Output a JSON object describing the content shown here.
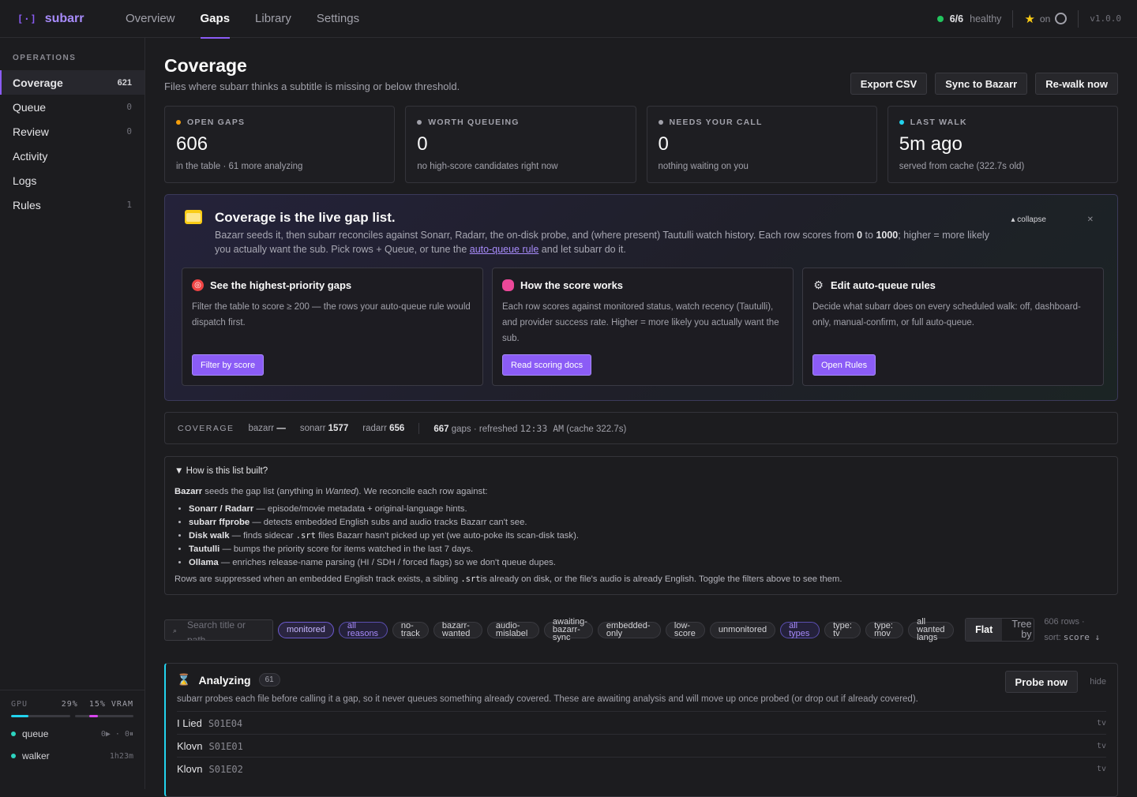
{
  "app": {
    "logo_mark": "[·]",
    "name": "subarr"
  },
  "nav": [
    {
      "label": "Overview"
    },
    {
      "label": "Gaps"
    },
    {
      "label": "Library"
    },
    {
      "label": "Settings"
    }
  ],
  "status": {
    "health_count": "6/6",
    "health_label": "healthy",
    "github_label": "on",
    "version": "v1.0.0",
    "colors": {
      "healthy": "#22c55e",
      "accent": "#8b5cf6"
    }
  },
  "sidebar": {
    "heading": "OPERATIONS",
    "items": [
      {
        "label": "Coverage",
        "count": "621"
      },
      {
        "label": "Queue",
        "count": "0"
      },
      {
        "label": "Review",
        "count": "0"
      },
      {
        "label": "Activity",
        "count": ""
      },
      {
        "label": "Logs",
        "count": ""
      },
      {
        "label": "Rules",
        "count": "1"
      }
    ],
    "gpu": {
      "label": "GPU",
      "util": "29%",
      "vram": "15% VRAM",
      "util_fraction": 0.29,
      "vram_fraction": 0.15
    },
    "procs": [
      {
        "name": "queue",
        "status": "0▶ · 0⏸"
      },
      {
        "name": "walker",
        "status": "1h23m"
      }
    ]
  },
  "page": {
    "title": "Coverage",
    "subtitle": "Files where subarr thinks a subtitle is missing or below threshold.",
    "actions": [
      "Export CSV",
      "Sync to Bazarr",
      "Re-walk now"
    ]
  },
  "stats": [
    {
      "label": "OPEN GAPS",
      "value": "606",
      "sub": "in the table · 61 more analyzing",
      "color": "#f59e0b"
    },
    {
      "label": "WORTH QUEUEING",
      "value": "0",
      "sub": "no high-score candidates right now",
      "color": "#a1a1aa"
    },
    {
      "label": "NEEDS YOUR CALL",
      "value": "0",
      "sub": "nothing waiting on you",
      "color": "#a1a1aa"
    },
    {
      "label": "LAST WALK",
      "value": "5m ago",
      "sub": "served from cache (322.7s old)",
      "color": "#22d3ee"
    }
  ],
  "hero": {
    "title": "Coverage is the live gap list.",
    "desc_1": "Bazarr seeds it, then subarr reconciles against Sonarr, Radarr, the on-disk probe, and (where present) Tautulli watch history. Each row scores from ",
    "score_min": "0",
    "desc_2": " to ",
    "score_max": "1000",
    "desc_3": "; higher = more likely you actually want the sub. Pick rows + Queue, or tune the ",
    "link": "auto-queue rule",
    "desc_4": " and let subarr do it.",
    "collapse": "▴ collapse",
    "close": "✕",
    "cards": [
      {
        "title": "See the highest-priority gaps",
        "text": "Filter the table to score ≥ 200 — the rows your auto-queue rule would dispatch first.",
        "button": "Filter by score",
        "icon": "target-icon"
      },
      {
        "title": "How the score works",
        "text": "Each row scores against monitored status, watch recency (Tautulli), and provider success rate. Higher = more likely you actually want the sub.",
        "button": "Read scoring docs",
        "icon": "brain-icon"
      },
      {
        "title": "Edit auto-queue rules",
        "text": "Decide what subarr does on every scheduled walk: off, dashboard-only, manual-confirm, or full auto-queue.",
        "button": "Open Rules",
        "icon": "gear-icon"
      }
    ]
  },
  "coverage": {
    "label": "COVERAGE",
    "bazarr_label": "bazarr",
    "bazarr_val": "—",
    "sonarr_label": "sonarr",
    "sonarr_val": "1577",
    "radarr_label": "radarr",
    "radarr_val": "656",
    "gaps": "667",
    "gaps_text": "gaps · refreshed",
    "time": "12:33 AM",
    "cache": "(cache 322.7s)"
  },
  "how": {
    "summary": "▼ How is this list built?",
    "intro_b": "Bazarr",
    "intro_1": " seeds the gap list (anything in ",
    "intro_i": "Wanted",
    "intro_2": "). We reconcile each row against:",
    "items": [
      {
        "b": "Sonarr / Radarr",
        "t": " — episode/movie metadata + original-language hints."
      },
      {
        "b": "subarr ffprobe",
        "t": " — detects embedded English subs and audio tracks Bazarr can't see."
      },
      {
        "b": "Disk walk",
        "t": " — finds sidecar ",
        "code": ".srt",
        "t2": " files Bazarr hasn't picked up yet (we auto-poke its scan-disk task)."
      },
      {
        "b": "Tautulli",
        "t": " — bumps the priority score for items watched in the last 7 days."
      },
      {
        "b": "Ollama",
        "t": " — enriches release-name parsing (HI / SDH / forced flags) so we don't queue dupes."
      }
    ],
    "foot_1": "Rows are suppressed when an embedded English track exists, a sibling ",
    "foot_code": ".srt",
    "foot_2": "is already on disk, or the file's audio is already English. Toggle the filters above to see them."
  },
  "filters": {
    "search_placeholder": "Search title or path...",
    "search_icon": "⌕",
    "chips": [
      {
        "label": "monitored",
        "state": "on"
      },
      {
        "label": "all reasons",
        "state": "on2"
      },
      {
        "label": "no-track",
        "state": ""
      },
      {
        "label": "bazarr-wanted",
        "state": ""
      },
      {
        "label": "audio-mislabel",
        "state": ""
      },
      {
        "label": "awaiting-bazarr-sync",
        "state": ""
      },
      {
        "label": "embedded-only",
        "state": ""
      },
      {
        "label": "low-score",
        "state": ""
      },
      {
        "label": "unmonitored",
        "state": ""
      },
      {
        "label": "all types",
        "state": "on2"
      },
      {
        "label": "type: tv",
        "state": ""
      },
      {
        "label": "type: mov",
        "state": ""
      },
      {
        "label": "all wanted langs",
        "state": ""
      }
    ],
    "view_flat": "Flat",
    "view_tree": "Tree by",
    "rows": "606 rows ·",
    "sort_label": "sort:",
    "sort_value": "score ↓"
  },
  "analyzing": {
    "title": "Analyzing",
    "count": "61",
    "desc": "subarr probes each file before calling it a gap, so it never queues something already covered. These are awaiting analysis and will move up once probed (or drop out if already covered).",
    "probe": "Probe now",
    "hide": "hide",
    "rows": [
      {
        "title": "I Lied",
        "ep": "S01E04",
        "type": "tv"
      },
      {
        "title": "Klovn",
        "ep": "S01E01",
        "type": "tv"
      },
      {
        "title": "Klovn",
        "ep": "S01E02",
        "type": "tv"
      }
    ]
  }
}
